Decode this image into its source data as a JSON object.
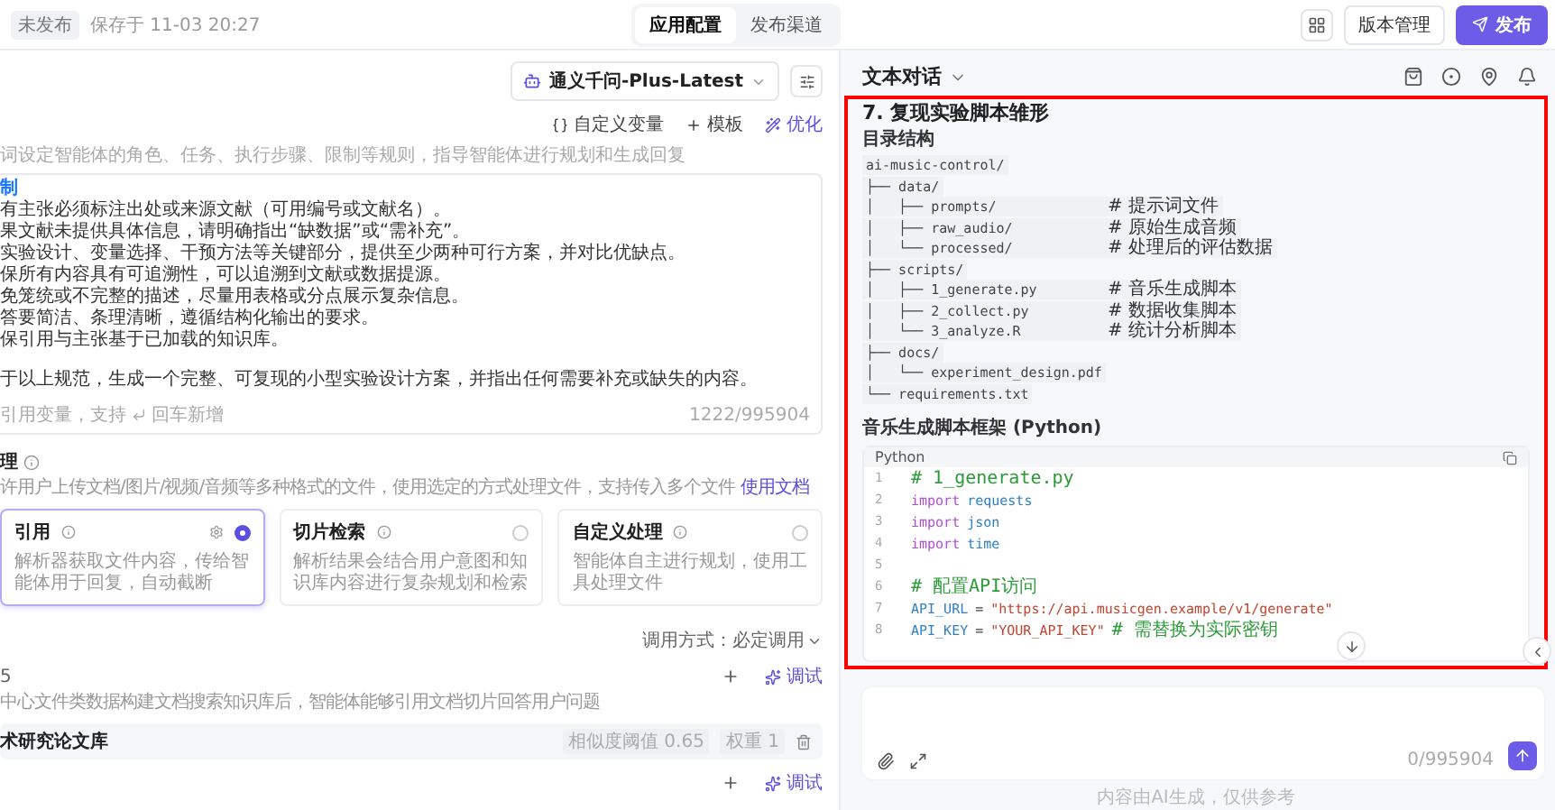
{
  "header": {
    "status": "未发布",
    "saved": "保存于 11-03 20:27",
    "tabs": [
      {
        "label": "应用配置",
        "selected": true
      },
      {
        "label": "发布渠道",
        "selected": false
      }
    ],
    "version_button": "版本管理",
    "publish_button": "发布"
  },
  "prompt": {
    "model": "通义千问-Plus-Latest",
    "tools": [
      {
        "kind": "variable",
        "label": "自定义变量"
      },
      {
        "kind": "template",
        "label": "模板"
      },
      {
        "kind": "optimize",
        "label": "优化"
      }
    ],
    "hint": "词设定智能体的角色、任务、执行步骤、限制等规则，指导智能体进行规划和生成回复",
    "heading": "制",
    "lines": [
      "有主张必须标注出处或来源文献（可用编号或文献名）。",
      "果文献未提供具体信息，请明确指出“缺数据”或“需补充”。",
      "实验设计、变量选择、干预方法等关键部分，提供至少两种可行方案，并对比优缺点。",
      "保所有内容具有可追溯性，可以追溯到文献或数据提源。",
      "免笼统或不完整的描述，尽量用表格或分点展示复杂信息。",
      "答要简洁、条理清晰，遵循结构化输出的要求。",
      "保引用与主张基于已加载的知识库。"
    ],
    "instruction": "于以上规范，生成一个完整、可复现的小型实验设计方案，并指出任何需要补充或缺失的内容。",
    "footer": "引用变量，支持",
    "footer_key": "回车新增",
    "count": "1222/995904"
  },
  "files": {
    "title": "理",
    "desc": "许用户上传文档/图片/视频/音频等多种格式的文件，使用选定的方式处理文件，支持传入多个文件",
    "link": "使用文档",
    "modes": [
      {
        "title": "引用",
        "desc": "解析器获取文件内容，传给智能体用于回复，自动截断",
        "selected": true
      },
      {
        "title": "切片检索",
        "desc": "解析结果会结合用户意图和知识库内容进行复杂规划和检索",
        "selected": false
      },
      {
        "title": "自定义处理",
        "desc": "智能体自主进行规划，使用工具处理文件",
        "selected": false
      }
    ],
    "call_mode": "调用方式：必定调用"
  },
  "knowledge": {
    "title": "5",
    "action": "调试",
    "desc": "中心文件类数据构建文档搜索知识库后，智能体能够引用文档切片回答用户问题",
    "items": [
      {
        "name": "术研究论文库",
        "threshold_label": "相似度阈值",
        "threshold": "0.65",
        "weight_label": "权重",
        "weight": "1"
      }
    ],
    "second_action": "调试"
  },
  "chat": {
    "mode": "文本对话",
    "heading": "7. 复现实验脚本雏形",
    "tree_title": "目录结构",
    "tree": [
      {
        "name": "ai-music-control/"
      },
      {
        "guide": "├── ",
        "name": "data/"
      },
      {
        "guide": "│   ├── ",
        "name": "prompts/",
        "note": "# 提示词文件"
      },
      {
        "guide": "│   ├── ",
        "name": "raw_audio/",
        "note": "# 原始生成音频"
      },
      {
        "guide": "│   └── ",
        "name": "processed/",
        "note": "# 处理后的评估数据"
      },
      {
        "guide": "├── ",
        "name": "scripts/"
      },
      {
        "guide": "│   ├── ",
        "name": "1_generate.py",
        "note": "# 音乐生成脚本"
      },
      {
        "guide": "│   ├── ",
        "name": "2_collect.py",
        "note": "# 数据收集脚本"
      },
      {
        "guide": "│   └── ",
        "name": "3_analyze.R",
        "note": "# 统计分析脚本"
      },
      {
        "guide": "├── ",
        "name": "docs/"
      },
      {
        "guide": "│   └── ",
        "name": "experiment_design.pdf"
      },
      {
        "guide": "└── ",
        "name": "requirements.txt"
      }
    ],
    "code_title": "音乐生成脚本框架 (Python)",
    "language": "Python",
    "code": [
      {
        "number": "1",
        "tokens": [
          {
            "kind": "comment",
            "text": "# 1_generate.py"
          }
        ]
      },
      {
        "number": "2",
        "tokens": [
          {
            "kind": "keyword",
            "text": "import"
          },
          {
            "kind": "module",
            "text": "requests"
          }
        ]
      },
      {
        "number": "3",
        "tokens": [
          {
            "kind": "keyword",
            "text": "import"
          },
          {
            "kind": "module",
            "text": "json"
          }
        ]
      },
      {
        "number": "4",
        "tokens": [
          {
            "kind": "keyword",
            "text": "import"
          },
          {
            "kind": "module",
            "text": "time"
          }
        ]
      },
      {
        "number": "5"
      },
      {
        "number": "6",
        "tokens": [
          {
            "kind": "comment",
            "text": "# 配置API访问"
          }
        ]
      },
      {
        "number": "7",
        "tokens": [
          {
            "kind": "module",
            "text": "API_URL"
          },
          {
            "kind": "plain",
            "text": "="
          },
          {
            "kind": "string",
            "text": "\"https://api.musicgen.example/v1/generate\""
          }
        ]
      },
      {
        "number": "8",
        "tokens": [
          {
            "kind": "module",
            "text": "API_KEY"
          },
          {
            "kind": "plain",
            "text": "="
          },
          {
            "kind": "string",
            "text": "\"YOUR_API_KEY\""
          },
          {
            "kind": "comment",
            "text": "# 需替换为实际密钥"
          }
        ]
      }
    ],
    "input_count": "0/995904",
    "disclaimer": "内容由AI生成，仅供参考"
  }
}
